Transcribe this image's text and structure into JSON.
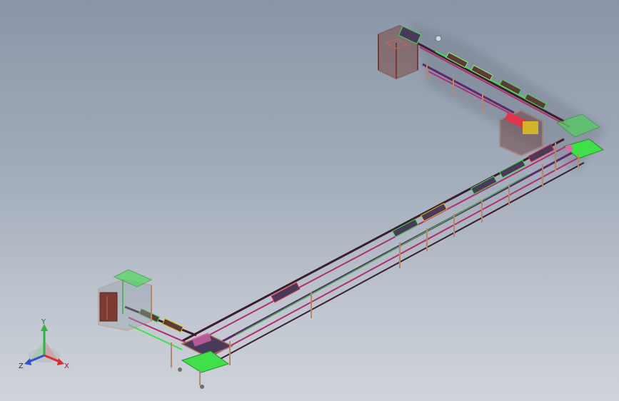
{
  "view_triad": {
    "x_label": "X",
    "y_label": "Y",
    "z_label": "Z",
    "x_color": "#d8302c",
    "y_color": "#2fb24a",
    "z_color": "#2f4fd8"
  },
  "colors": {
    "rail_dark": "#3a1f2e",
    "rail_magenta": "#b0306e",
    "rail_purple": "#5c2a6a",
    "frame_brown": "#7a3b33",
    "station_green": "#3fe04a",
    "station_lime": "#8cf06a",
    "station_yellow": "#e0c21c",
    "station_red": "#e0344a"
  }
}
